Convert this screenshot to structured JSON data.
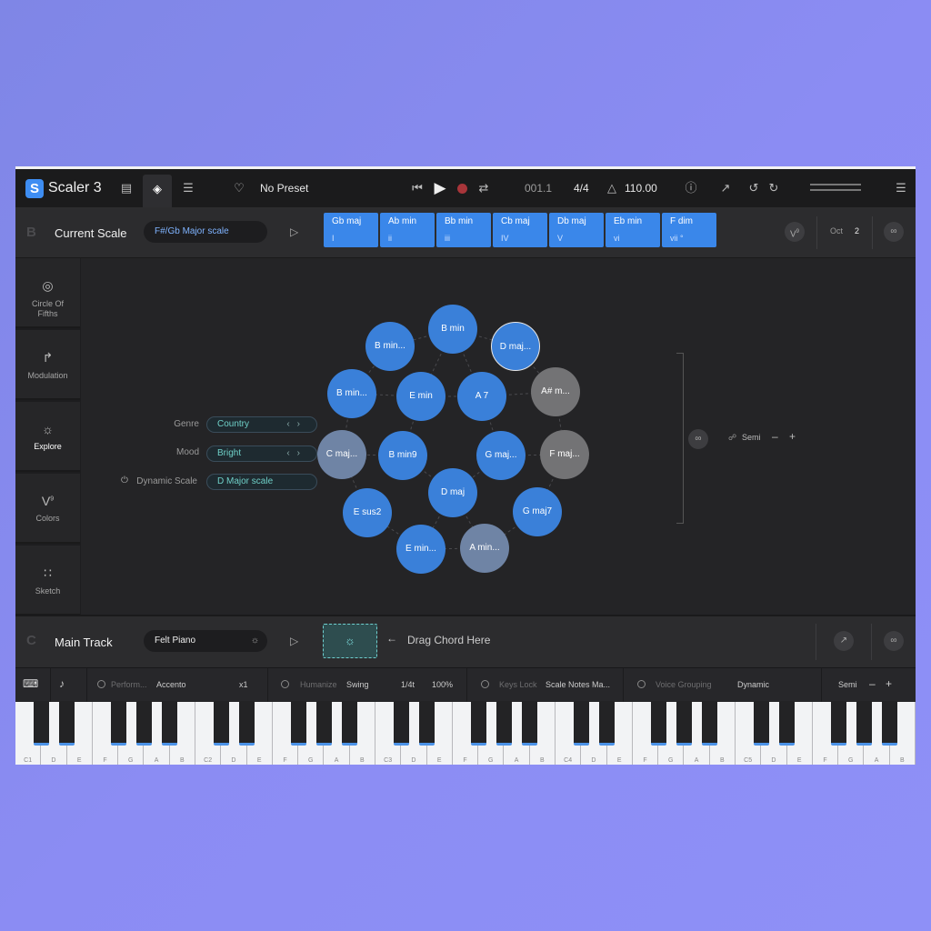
{
  "app": {
    "name": "Scaler 3",
    "logo_letter": "S",
    "preset": "No Preset",
    "position": "001.1",
    "time_signature": "4/4",
    "tempo": "110.00"
  },
  "scale_section": {
    "letter": "B",
    "title": "Current Scale",
    "scale_name": "F#/Gb Major scale",
    "chords": [
      {
        "name": "Gb maj",
        "degree": "I"
      },
      {
        "name": "Ab min",
        "degree": "ii"
      },
      {
        "name": "Bb min",
        "degree": "iii"
      },
      {
        "name": "Cb maj",
        "degree": "IV"
      },
      {
        "name": "Db maj",
        "degree": "V"
      },
      {
        "name": "Eb min",
        "degree": "vi"
      },
      {
        "name": "F dim",
        "degree": "vii °"
      }
    ],
    "voicing_label": "V",
    "voicing_superscript": "9",
    "octave_label": "Oct",
    "octave_value": "2"
  },
  "sidebar": {
    "items": [
      {
        "label": "Circle Of Fifths",
        "icon": "target-icon"
      },
      {
        "label": "Modulation",
        "icon": "step-arrow-icon"
      },
      {
        "label": "Explore",
        "icon": "lightbulb-icon"
      },
      {
        "label": "Colors",
        "icon": "v9-icon"
      },
      {
        "label": "Sketch",
        "icon": "grid-icon"
      }
    ]
  },
  "explore": {
    "genre_label": "Genre",
    "genre_value": "Country",
    "mood_label": "Mood",
    "mood_value": "Bright",
    "dynamic_label": "Dynamic Scale",
    "dynamic_value": "D Major scale",
    "semi_label": "Semi",
    "nodes": [
      {
        "label": "B min",
        "color": "blue"
      },
      {
        "label": "B min...",
        "color": "blue"
      },
      {
        "label": "D maj...",
        "color": "blue",
        "selected": true
      },
      {
        "label": "B min...",
        "color": "blue"
      },
      {
        "label": "E min",
        "color": "blue"
      },
      {
        "label": "A 7",
        "color": "blue"
      },
      {
        "label": "A# m...",
        "color": "gray"
      },
      {
        "label": "C maj...",
        "color": "slate"
      },
      {
        "label": "B min9",
        "color": "blue"
      },
      {
        "label": "G maj...",
        "color": "blue"
      },
      {
        "label": "F maj...",
        "color": "gray"
      },
      {
        "label": "D maj",
        "color": "blue"
      },
      {
        "label": "E sus2",
        "color": "blue"
      },
      {
        "label": "G maj7",
        "color": "blue"
      },
      {
        "label": "E min...",
        "color": "blue"
      },
      {
        "label": "A min...",
        "color": "slate"
      }
    ]
  },
  "track": {
    "letter": "C",
    "title": "Main Track",
    "instrument": "Felt Piano",
    "drag_hint": "Drag Chord Here"
  },
  "options": {
    "perform_label": "Perform...",
    "perform_value": "Accento",
    "perform_mult": "x1",
    "humanize_label": "Humanize",
    "humanize_value": "Swing",
    "humanize_div": "1/4t",
    "humanize_pct": "100%",
    "keyslock_label": "Keys Lock",
    "keyslock_value": "Scale Notes Ma...",
    "voice_label": "Voice Grouping",
    "voice_value": "Dynamic",
    "semi_label": "Semi"
  },
  "keyboard": {
    "white_keys": [
      "C1",
      "D",
      "E",
      "F",
      "G",
      "A",
      "B",
      "C2",
      "D",
      "E",
      "F",
      "G",
      "A",
      "B",
      "C3",
      "D",
      "E",
      "F",
      "G",
      "A",
      "B",
      "C4",
      "D",
      "E",
      "F",
      "G",
      "A",
      "B",
      "C5",
      "D",
      "E",
      "F",
      "G",
      "A",
      "B"
    ],
    "accent_color": "#4c93e8"
  },
  "colors": {
    "accent_blue": "#3a87ea",
    "teal": "#6fd0c8",
    "background": "#8b8cf3"
  }
}
